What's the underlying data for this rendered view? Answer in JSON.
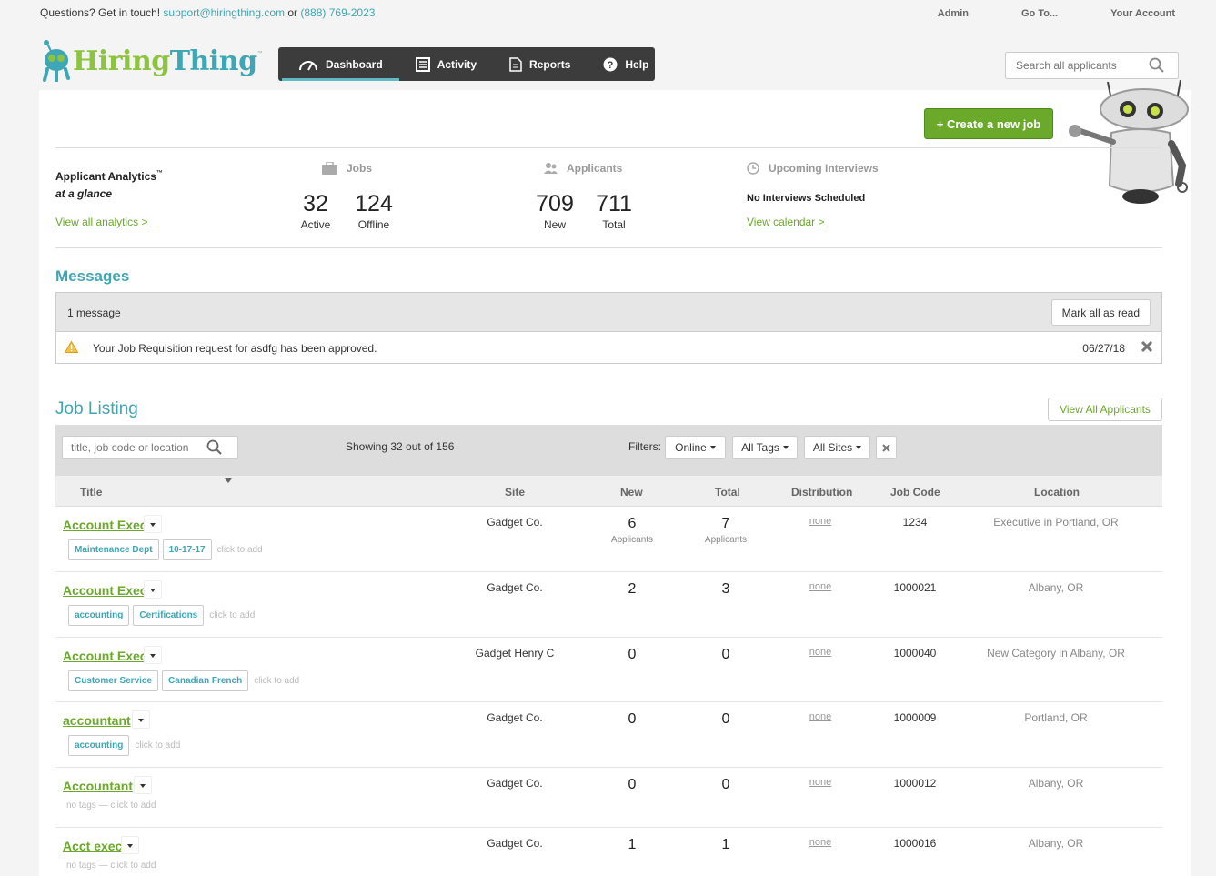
{
  "topbar": {
    "contact_prefix": "Questions? Get in touch!",
    "email": "support@hiringthing.com",
    "or": "or",
    "phone": "(888) 769-2023",
    "links": [
      "Admin",
      "Go To...",
      "Your Account"
    ]
  },
  "logo": {
    "part1": "Hiring",
    "part2": "Thing",
    "tm": "™"
  },
  "nav": {
    "items": [
      {
        "label": "Dashboard",
        "icon": "speedometer-icon",
        "active": true
      },
      {
        "label": "Activity",
        "icon": "list-icon",
        "active": false
      },
      {
        "label": "Reports",
        "icon": "document-icon",
        "active": false
      },
      {
        "label": "Help",
        "icon": "help-icon",
        "active": false
      }
    ]
  },
  "search": {
    "placeholder": "Search all applicants"
  },
  "create_job": "+ Create a new job",
  "analytics": {
    "title": "Applicant Analytics",
    "tm": "™",
    "subtitle": "at a glance",
    "link": "View all analytics >",
    "jobs": {
      "label": "Jobs",
      "active": "32",
      "active_label": "Active",
      "offline": "124",
      "offline_label": "Offline"
    },
    "applicants": {
      "label": "Applicants",
      "new": "709",
      "new_label": "New",
      "total": "711",
      "total_label": "Total"
    },
    "interviews": {
      "label": "Upcoming Interviews",
      "status": "No Interviews Scheduled",
      "link": "View calendar >"
    }
  },
  "messages": {
    "title": "Messages",
    "count": "1 message",
    "mark_all": "Mark all as read",
    "items": [
      {
        "text": "Your Job Requisition request for asdfg has been approved.",
        "date": "06/27/18"
      }
    ]
  },
  "job_listing": {
    "title": "Job Listing",
    "view_all": "View All Applicants",
    "search_placeholder": "title, job code or location",
    "showing": "Showing 32 out of 156",
    "filters_label": "Filters:",
    "filters": [
      "Online",
      "All Tags",
      "All Sites"
    ],
    "columns": [
      "Title",
      "Site",
      "New",
      "Total",
      "Distribution",
      "Job Code",
      "Location"
    ],
    "applicants_label": "Applicants",
    "click_to_add": "click to add",
    "no_tags": "no tags — click to add",
    "rows": [
      {
        "title": "Account Exec",
        "site": "Gadget Co.",
        "new": "6",
        "total": "7",
        "distribution": "none",
        "code": "1234",
        "location": "Executive in Portland, OR",
        "tags": [
          "Maintenance Dept",
          "10-17-17"
        ],
        "show_labels": true
      },
      {
        "title": "Account Exec",
        "site": "Gadget Co.",
        "new": "2",
        "total": "3",
        "distribution": "none",
        "code": "1000021",
        "location": "Albany, OR",
        "tags": [
          "accounting",
          "Certifications"
        ],
        "show_labels": false
      },
      {
        "title": "Account Exec",
        "site": "Gadget Henry C",
        "new": "0",
        "total": "0",
        "distribution": "none",
        "code": "1000040",
        "location": "New Category in Albany, OR",
        "tags": [
          "Customer Service",
          "Canadian French"
        ],
        "show_labels": false
      },
      {
        "title": "accountant",
        "site": "Gadget Co.",
        "new": "0",
        "total": "0",
        "distribution": "none",
        "code": "1000009",
        "location": "Portland, OR",
        "tags": [
          "accounting"
        ],
        "show_labels": false
      },
      {
        "title": "Accountant",
        "site": "Gadget Co.",
        "new": "0",
        "total": "0",
        "distribution": "none",
        "code": "1000012",
        "location": "Albany, OR",
        "tags": [],
        "show_labels": false
      },
      {
        "title": "Acct exec",
        "site": "Gadget Co.",
        "new": "1",
        "total": "1",
        "distribution": "none",
        "code": "1000016",
        "location": "Albany, OR",
        "tags": [],
        "show_labels": false
      }
    ]
  },
  "colors": {
    "green": "#6aa92a",
    "teal": "#3ea6b5",
    "nav_bg": "#3c3c3c"
  }
}
